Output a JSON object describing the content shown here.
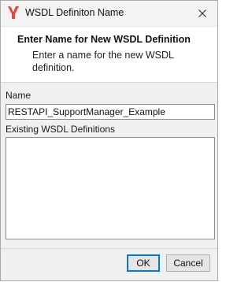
{
  "window": {
    "title": "WSDL Definiton Name",
    "icon": "app-logo-icon",
    "close_icon": "close-icon"
  },
  "banner": {
    "title": "Enter Name for New WSDL Definition",
    "description": "Enter a name for the new WSDL definition."
  },
  "form": {
    "name_label": "Name",
    "name_value": "RESTAPI_SupportManager_Example",
    "existing_label": "Existing WSDL Definitions",
    "existing_items": []
  },
  "buttons": {
    "ok": "OK",
    "cancel": "Cancel"
  },
  "colors": {
    "accent": "#0078d4",
    "logo_red": "#e8453c"
  }
}
